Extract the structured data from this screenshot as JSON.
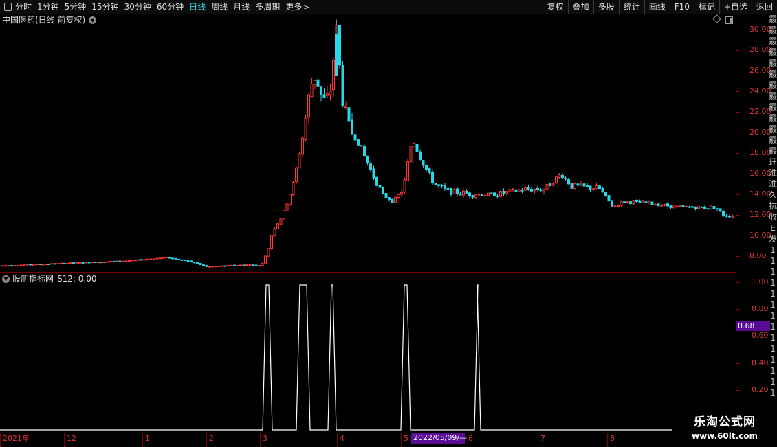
{
  "toolbar": {
    "periods": [
      "分时",
      "1分钟",
      "5分钟",
      "15分钟",
      "30分钟",
      "60分钟",
      "日线",
      "周线",
      "月线",
      "多周期",
      "更多"
    ],
    "active_period": "日线",
    "right_buttons": [
      "复权",
      "叠加",
      "多股",
      "统计",
      "画线",
      "F10",
      "标记",
      "+自选",
      "返回"
    ]
  },
  "main_chart": {
    "title": "中国医药(日线 前复权)",
    "price_ticks": [
      "30.00",
      "28.00",
      "26.00",
      "24.00",
      "22.00",
      "20.00",
      "18.00",
      "16.00",
      "14.00",
      "12.00",
      "10.00",
      "8.00"
    ]
  },
  "indicator": {
    "name": "股朋指标网",
    "value_text": "S12: 0.00",
    "ticks": [
      "1.00",
      "0.80",
      "0.60",
      "0.40",
      "0.20"
    ],
    "cursor_value": "0.68"
  },
  "date_axis": {
    "labels": [
      "2021年",
      "12",
      "1",
      "2",
      "3",
      "4",
      "5",
      "6",
      "7",
      "8"
    ],
    "cursor_date": "2022/05/09/—"
  },
  "right_strip_chars": [
    "霰",
    "霰",
    "霰",
    "霰",
    "霰",
    "霰",
    "霰",
    "霰",
    "霰",
    "霰",
    "霰",
    "霰",
    "霰",
    "玨",
    "淮",
    "淮",
    "久",
    "抗",
    "收",
    "",
    "",
    "E",
    "发",
    "1",
    "1",
    "1",
    "1",
    "1",
    "1",
    "1",
    "1",
    "1",
    "1",
    "1",
    "1",
    "1",
    "1"
  ],
  "watermark": {
    "title": "乐淘公式网",
    "url": "www.60lt.com"
  },
  "colors": {
    "up": "#ff3333",
    "down": "#29d8e6",
    "active": "#3ecfe8",
    "axis_text": "#dd3333",
    "highlight": "#5a0b96"
  },
  "chart_data": [
    {
      "type": "candlestick",
      "title": "中国医药(日线 前复权)",
      "ylim": [
        6.5,
        31.5
      ],
      "x": [
        "2021-11",
        "2021-12",
        "2022-01",
        "2022-02",
        "2022-03",
        "2022-04",
        "2022-05",
        "2022-06",
        "2022-07",
        "2022-08"
      ],
      "close": [
        7.1,
        7.3,
        7.8,
        7.0,
        12.0,
        25.5,
        19.5,
        16.0,
        14.5,
        12.8,
        11.8
      ],
      "peak_high": 31.0,
      "last_close": 11.9
    },
    {
      "type": "line",
      "title": "股朋指标网",
      "series": [
        {
          "name": "S12",
          "values": [
            0,
            0,
            0,
            0,
            1,
            1,
            1,
            0,
            1,
            0,
            1,
            0,
            0,
            0
          ]
        }
      ],
      "ylim": [
        0,
        1.1
      ]
    }
  ]
}
